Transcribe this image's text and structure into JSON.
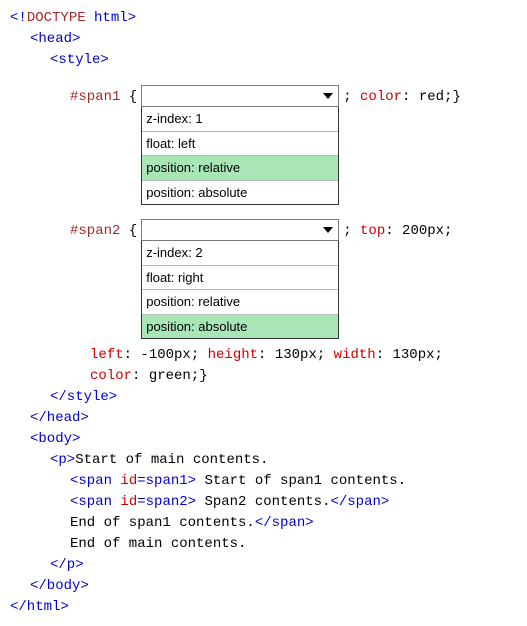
{
  "code": {
    "doctype_open": "<!",
    "doctype_word": "DOCTYPE",
    "doctype_rest": " html",
    "doctype_close": ">",
    "head_open": "<head>",
    "style_open": "<style>",
    "span1_sel": "#span1 ",
    "brace_open": "{",
    "rule1_after": "; ",
    "rule1_prop": "color",
    "rule1_val": ": red;}",
    "span2_sel": "#span2 ",
    "rule2_after": "; ",
    "rule2_prop": "top",
    "rule2_val": ": 200px;",
    "cont_line1_a": "left",
    "cont_line1_b": ": -100px; ",
    "cont_line1_c": "height",
    "cont_line1_d": ": 130px; ",
    "cont_line1_e": "width",
    "cont_line1_f": ": 130px;",
    "cont_line2_a": "color",
    "cont_line2_b": ": green;}",
    "style_close": "</style>",
    "head_close": "</head>",
    "body_open": "<body>",
    "p_open": "<p>",
    "p_text1": "Start of main contents.",
    "span1_tag_a": "<span ",
    "span1_tag_b": "id",
    "span1_tag_c": "=span1>",
    "span1_text": " Start of span1 contents.",
    "span2_tag_a": "<span ",
    "span2_tag_b": "id",
    "span2_tag_c": "=span2>",
    "span2_text": " Span2 contents.",
    "span_close": "</span>",
    "end_span1": "End of span1 contents.",
    "end_main": "End of main contents.",
    "p_close": "</p>",
    "body_close": "</body>",
    "html_close": "</html>"
  },
  "dropdown1": {
    "options": {
      "0": "z-index: 1",
      "1": "float: left",
      "2": "position: relative",
      "3": "position: absolute"
    },
    "correct_index": 2
  },
  "dropdown2": {
    "options": {
      "0": "z-index: 2",
      "1": "float: right",
      "2": "position: relative",
      "3": "position: absolute"
    },
    "correct_index": 3
  }
}
